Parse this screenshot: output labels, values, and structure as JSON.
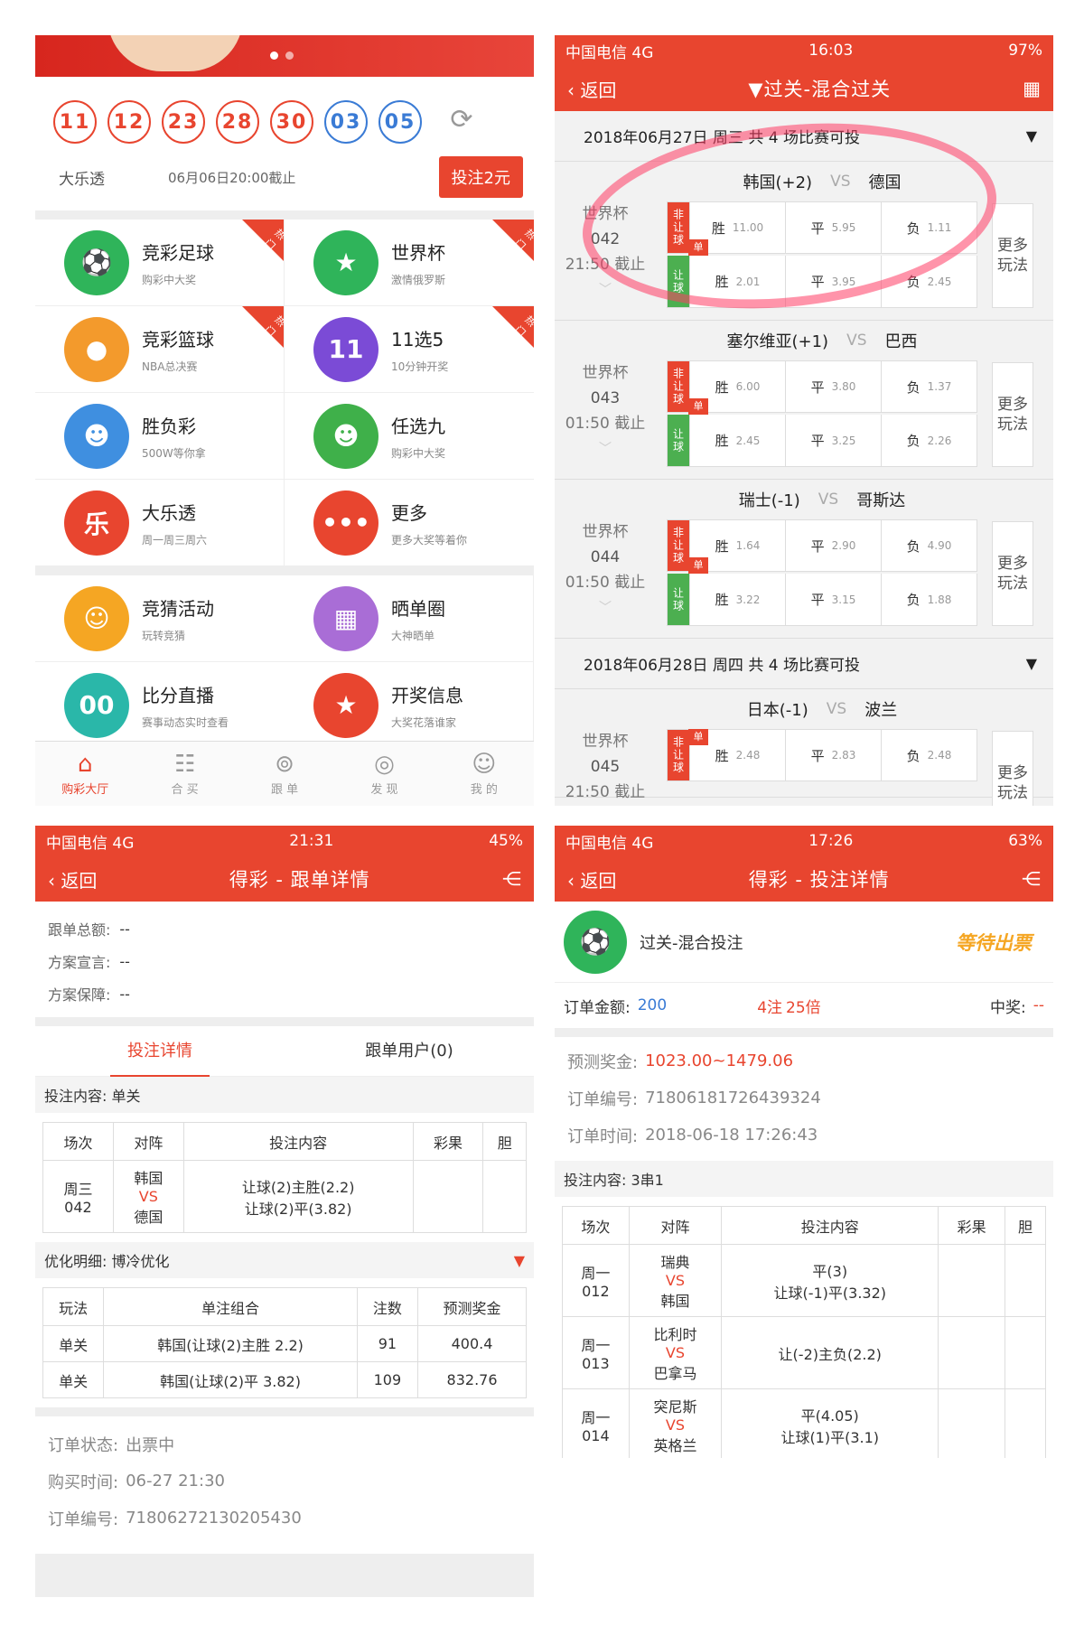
{
  "p1": {
    "balls_red": [
      "11",
      "12",
      "23",
      "28",
      "30"
    ],
    "balls_blue": [
      "03",
      "05"
    ],
    "lotto_name": "大乐透",
    "deadline": "06月06日20:00截止",
    "bet_button": "投注2元",
    "grid": [
      {
        "title": "竞彩足球",
        "sub": "购彩中大奖",
        "hot": "热门",
        "icon": "soccer-icon",
        "color": "#2fb45a"
      },
      {
        "title": "世界杯",
        "sub": "激情俄罗斯",
        "hot": "热门",
        "icon": "trophy-icon",
        "color": "#2fb45a"
      },
      {
        "title": "竞彩篮球",
        "sub": "NBA总决赛",
        "hot": "热门",
        "icon": "basketball-icon",
        "color": "#f39a2c"
      },
      {
        "title": "11选5",
        "sub": "10分钟开奖",
        "hot": "热门",
        "icon": "lottery-ball-icon",
        "color": "#7b4bd6"
      },
      {
        "title": "胜负彩",
        "sub": "500W等你拿",
        "hot": "",
        "icon": "mascot-icon",
        "color": "#3f8fe0"
      },
      {
        "title": "任选九",
        "sub": "购彩中大奖",
        "hot": "",
        "icon": "mascot-icon",
        "color": "#3fb04a"
      },
      {
        "title": "大乐透",
        "sub": "周一周三周六",
        "hot": "",
        "icon": "super-lotto-icon",
        "color": "#e8452f"
      },
      {
        "title": "更多",
        "sub": "更多大奖等着你",
        "hot": "",
        "icon": "more-icon",
        "color": "#e8452f"
      },
      {
        "title": "竞猜活动",
        "sub": "玩转竞猜",
        "hot": "",
        "icon": "kid-icon",
        "color": "#f5a623"
      },
      {
        "title": "晒单圈",
        "sub": "大神晒单",
        "hot": "",
        "icon": "bingo-icon",
        "color": "#a96dd6"
      },
      {
        "title": "比分直播",
        "sub": "赛事动态实时查看",
        "hot": "",
        "icon": "scoreboard-icon",
        "color": "#2ab7a9"
      },
      {
        "title": "开奖信息",
        "sub": "大奖花落谁家",
        "hot": "",
        "icon": "trophy-icon",
        "color": "#e8452f"
      }
    ],
    "tabs": [
      "购彩大厅",
      "合 买",
      "跟 单",
      "发 现",
      "我 的"
    ]
  },
  "p2": {
    "status": {
      "carrier": "中国电信  4G",
      "time": "16:03",
      "battery": "97%"
    },
    "back": "返回",
    "title": "▼过关-混合过关",
    "date1": "2018年06月27日 周三 共 4 场比赛可投",
    "date2": "2018年06月28日 周四 共 4 场比赛可投",
    "matches": [
      {
        "home": "韩国(+2)",
        "away": "德国",
        "league": "世界杯",
        "num": "042",
        "time": "21:50 截止",
        "row1": [
          [
            "胜",
            "11.00"
          ],
          [
            "平",
            "5.95"
          ],
          [
            "负",
            "1.11"
          ]
        ],
        "row2": [
          [
            "胜",
            "2.01"
          ],
          [
            "平",
            "3.95"
          ],
          [
            "负",
            "2.45"
          ]
        ]
      },
      {
        "home": "塞尔维亚(+1)",
        "away": "巴西",
        "league": "世界杯",
        "num": "043",
        "time": "01:50 截止",
        "row1": [
          [
            "胜",
            "6.00"
          ],
          [
            "平",
            "3.80"
          ],
          [
            "负",
            "1.37"
          ]
        ],
        "row2": [
          [
            "胜",
            "2.45"
          ],
          [
            "平",
            "3.25"
          ],
          [
            "负",
            "2.26"
          ]
        ]
      },
      {
        "home": "瑞士(-1)",
        "away": "哥斯达",
        "league": "世界杯",
        "num": "044",
        "time": "01:50 截止",
        "row1": [
          [
            "胜",
            "1.64"
          ],
          [
            "平",
            "2.90"
          ],
          [
            "负",
            "4.90"
          ]
        ],
        "row2": [
          [
            "胜",
            "3.22"
          ],
          [
            "平",
            "3.15"
          ],
          [
            "负",
            "1.88"
          ]
        ]
      },
      {
        "home": "日本(-1)",
        "away": "波兰",
        "league": "世界杯",
        "num": "045",
        "time": "21:50 截止",
        "row1": [
          [
            "胜",
            "2.48"
          ],
          [
            "平",
            "2.83"
          ],
          [
            "负",
            "2.48"
          ]
        ]
      }
    ],
    "tag_nonhandicap": "非让球",
    "tag_handicap": "让球",
    "dan": "单",
    "vs": "VS",
    "more": "更多玩法"
  },
  "p3": {
    "status": {
      "carrier": "中国电信  4G",
      "time": "21:31",
      "battery": "45%"
    },
    "back": "返回",
    "title": "得彩 - 跟单详情",
    "rows": [
      [
        "跟单总额:",
        "--"
      ],
      [
        "方案宣言:",
        "--"
      ],
      [
        "方案保障:",
        "--"
      ]
    ],
    "tab1": "投注详情",
    "tab2": "跟单用户(0)",
    "bet_content": "投注内容: 单关",
    "th": [
      "场次",
      "对阵",
      "投注内容",
      "彩果",
      "胆"
    ],
    "row": {
      "day": "周三",
      "num": "042",
      "home": "韩国",
      "away": "德国",
      "c1": "让球(2)主胜(2.2)",
      "c2": "让球(2)平(3.82)"
    },
    "opt": "优化明细: 博冷优化",
    "th2": [
      "玩法",
      "单注组合",
      "注数",
      "预测奖金"
    ],
    "rows2": [
      [
        "单关",
        "韩国(让球(2)主胜 2.2)",
        "91",
        "400.4"
      ],
      [
        "单关",
        "韩国(让球(2)平 3.82)",
        "109",
        "832.76"
      ]
    ],
    "status_rows": [
      [
        "订单状态:",
        "出票中"
      ],
      [
        "购买时间:",
        "06-27 21:30"
      ],
      [
        "订单编号:",
        "71806272130205430"
      ]
    ]
  },
  "p4": {
    "status": {
      "carrier": "中国电信  4G",
      "time": "17:26",
      "battery": "63%"
    },
    "back": "返回",
    "title": "得彩 - 投注详情",
    "play": "过关-混合投注",
    "stamp": "等待出票",
    "amount_label": "订单金额:",
    "amount": "200",
    "notes": "4注",
    "mult": "25倍",
    "win_label": "中奖:",
    "win": "--",
    "pred_label": "预测奖金:",
    "pred": "1023.00~1479.06",
    "id_label": "订单编号:",
    "id": "71806181726439324",
    "time_label": "订单时间:",
    "time": "2018-06-18 17:26:43",
    "bet_content": "投注内容: 3串1",
    "th": [
      "场次",
      "对阵",
      "投注内容",
      "彩果",
      "胆"
    ],
    "rows": [
      {
        "day": "周一",
        "num": "012",
        "home": "瑞典",
        "away": "韩国",
        "c": [
          "平(3)",
          "让球(-1)平(3.32)"
        ]
      },
      {
        "day": "周一",
        "num": "013",
        "home": "比利时",
        "away": "巴拿马",
        "c": [
          "让(-2)主负(2.2)"
        ]
      },
      {
        "day": "周一",
        "num": "014",
        "home": "突尼斯",
        "away": "英格兰",
        "c": [
          "平(4.05)",
          "让球(1)平(3.1)"
        ]
      }
    ]
  }
}
